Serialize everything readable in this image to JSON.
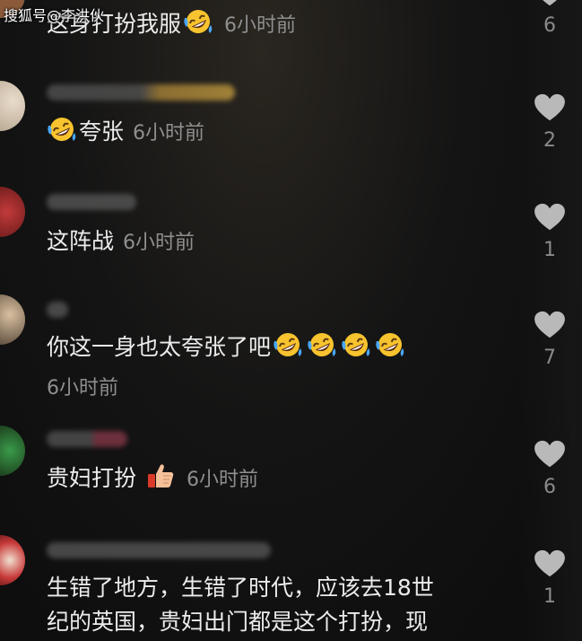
{
  "watermark": "搜狐号@李洪伙",
  "comments": [
    {
      "text": "这身打扮我服",
      "time": "6小时前",
      "likes": "6"
    },
    {
      "text": "夸张",
      "time": "6小时前",
      "likes": "2"
    },
    {
      "text": "这阵战",
      "time": "6小时前",
      "likes": "1"
    },
    {
      "text": "你这一身也太夸张了吧",
      "time": "6小时前",
      "likes": "7"
    },
    {
      "text": "贵妇打扮",
      "time": "6小时前",
      "likes": "6"
    },
    {
      "text_line1": "生错了地方，生错了时代，应该去18世",
      "text_line2": "纪的英国，贵妇出门都是这个打扮，现",
      "likes": "1"
    }
  ],
  "icons": {
    "emoji": "rofl-emoji",
    "thumb": "thumbs-up-emoji",
    "like": "heart-icon"
  }
}
